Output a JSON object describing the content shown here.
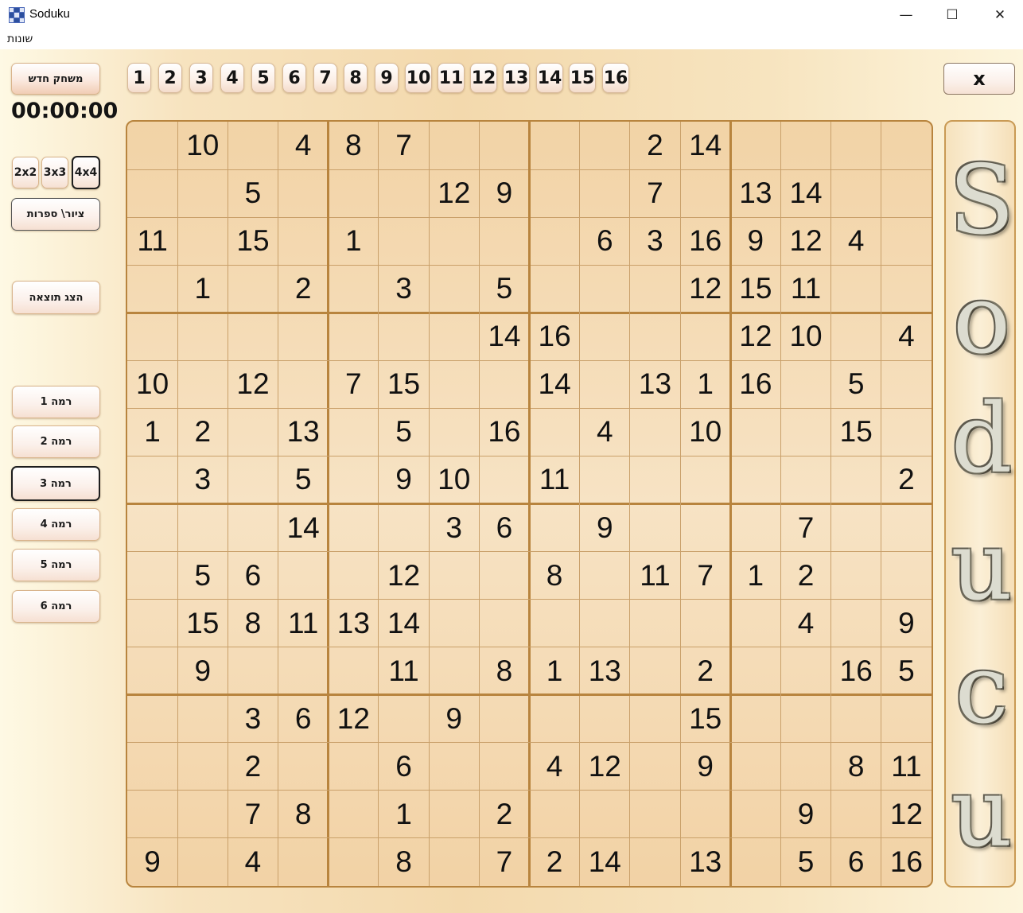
{
  "window": {
    "title": "Soduku",
    "minimize_glyph": "—",
    "maximize_glyph": "☐",
    "close_glyph": "✕"
  },
  "menu": {
    "items": [
      "שונות"
    ]
  },
  "controls": {
    "new_game_label": "משחק חדש",
    "timer": "00:00:00",
    "size_options": [
      "2x2",
      "3x3",
      "4x4"
    ],
    "selected_size": "4x4",
    "draw_digits_label": "ציור\\ ספרות",
    "show_result_label": "הצג תוצאה",
    "levels": [
      "רמה 1",
      "רמה 2",
      "רמה 3",
      "רמה 4",
      "רמה 5",
      "רמה 6"
    ],
    "selected_level": "רמה 3",
    "close_label": "x"
  },
  "number_palette": [
    "1",
    "2",
    "3",
    "4",
    "5",
    "6",
    "7",
    "8",
    "9",
    "10",
    "11",
    "12",
    "13",
    "14",
    "15",
    "16"
  ],
  "board": {
    "size": 16,
    "block": 4,
    "cells": [
      [
        "",
        "10",
        "",
        "4",
        "8",
        "7",
        "",
        "",
        "",
        "",
        "2",
        "14",
        "",
        "",
        "",
        ""
      ],
      [
        "",
        "",
        "5",
        "",
        "",
        "",
        "12",
        "9",
        "",
        "",
        "7",
        "",
        "13",
        "14",
        "",
        ""
      ],
      [
        "11",
        "",
        "15",
        "",
        "1",
        "",
        "",
        "",
        "",
        "6",
        "3",
        "16",
        "9",
        "12",
        "4",
        ""
      ],
      [
        "",
        "1",
        "",
        "2",
        "",
        "3",
        "",
        "5",
        "",
        "",
        "",
        "12",
        "15",
        "11",
        "",
        ""
      ],
      [
        "",
        "",
        "",
        "",
        "",
        "",
        "",
        "14",
        "16",
        "",
        "",
        "",
        "12",
        "10",
        "",
        "4"
      ],
      [
        "10",
        "",
        "12",
        "",
        "7",
        "15",
        "",
        "",
        "14",
        "",
        "13",
        "1",
        "16",
        "",
        "5",
        ""
      ],
      [
        "1",
        "2",
        "",
        "13",
        "",
        "5",
        "",
        "16",
        "",
        "4",
        "",
        "10",
        "",
        "",
        "15",
        ""
      ],
      [
        "",
        "3",
        "",
        "5",
        "",
        "9",
        "10",
        "",
        "11",
        "",
        "",
        "",
        "",
        "",
        "",
        "2"
      ],
      [
        "",
        "",
        "",
        "14",
        "",
        "",
        "3",
        "6",
        "",
        "9",
        "",
        "",
        "",
        "7",
        "",
        ""
      ],
      [
        "",
        "5",
        "6",
        "",
        "",
        "12",
        "",
        "",
        "8",
        "",
        "11",
        "7",
        "1",
        "2",
        "",
        ""
      ],
      [
        "",
        "15",
        "8",
        "11",
        "13",
        "14",
        "",
        "",
        "",
        "",
        "",
        "",
        "",
        "4",
        "",
        "9"
      ],
      [
        "",
        "9",
        "",
        "",
        "",
        "11",
        "",
        "8",
        "1",
        "13",
        "",
        "2",
        "",
        "",
        "16",
        "5"
      ],
      [
        "",
        "",
        "3",
        "6",
        "12",
        "",
        "9",
        "",
        "",
        "",
        "",
        "15",
        "",
        "",
        "",
        ""
      ],
      [
        "",
        "",
        "2",
        "",
        "",
        "6",
        "",
        "",
        "4",
        "12",
        "",
        "9",
        "",
        "",
        "8",
        "11"
      ],
      [
        "",
        "",
        "7",
        "8",
        "",
        "1",
        "",
        "2",
        "",
        "",
        "",
        "",
        "",
        "9",
        "",
        "12"
      ],
      [
        "9",
        "",
        "4",
        "",
        "",
        "8",
        "",
        "7",
        "2",
        "14",
        "",
        "13",
        "",
        "5",
        "6",
        "16"
      ]
    ]
  },
  "logo": {
    "letters": [
      "S",
      "o",
      "d",
      "u",
      "c",
      "u"
    ]
  }
}
